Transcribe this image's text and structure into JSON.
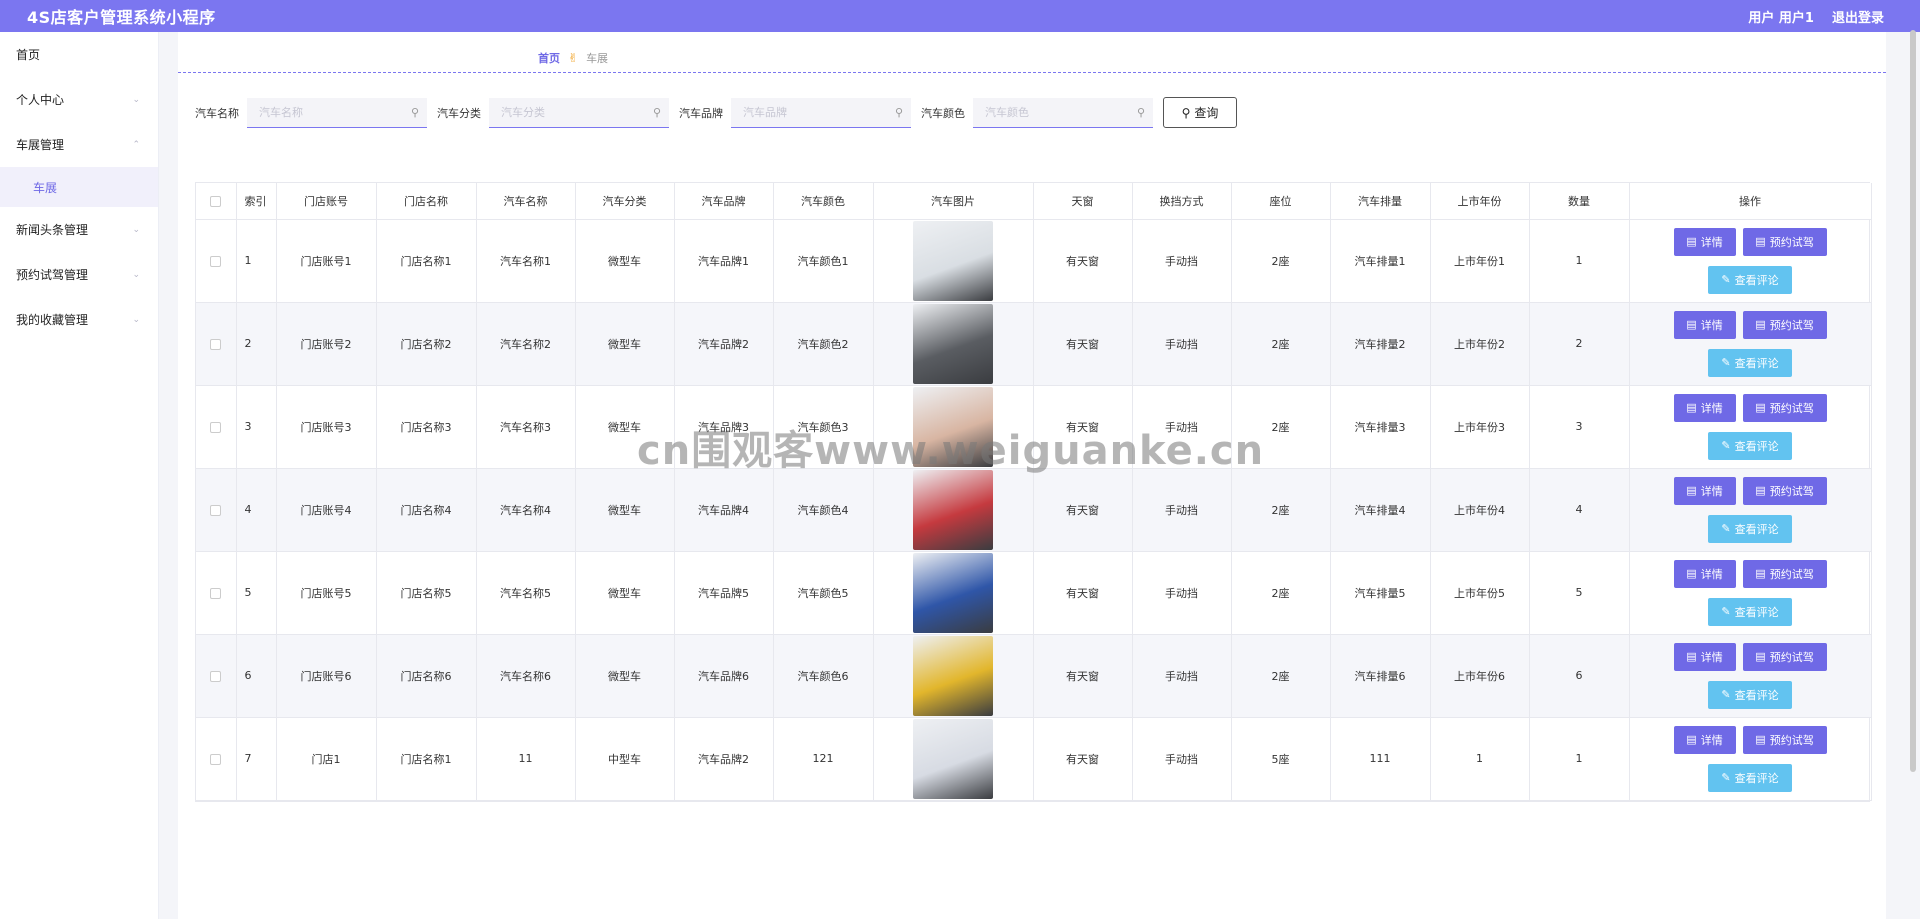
{
  "app": {
    "title": "4S店客户管理系统小程序",
    "user_label": "用户 用户1",
    "logout_label": "退出登录"
  },
  "sidebar": {
    "items": [
      {
        "label": "首页"
      },
      {
        "label": "个人中心"
      },
      {
        "label": "车展管理"
      },
      {
        "label": "车展"
      },
      {
        "label": "新闻头条管理"
      },
      {
        "label": "预约试驾管理"
      },
      {
        "label": "我的收藏管理"
      }
    ]
  },
  "breadcrumb": {
    "home": "首页",
    "current": "车展"
  },
  "search": {
    "fields": [
      {
        "label": "汽车名称",
        "placeholder": "汽车名称"
      },
      {
        "label": "汽车分类",
        "placeholder": "汽车分类"
      },
      {
        "label": "汽车品牌",
        "placeholder": "汽车品牌"
      },
      {
        "label": "汽车颜色",
        "placeholder": "汽车颜色"
      }
    ],
    "query_label": "查询"
  },
  "table": {
    "headers": [
      "索引",
      "门店账号",
      "门店名称",
      "汽车名称",
      "汽车分类",
      "汽车品牌",
      "汽车颜色",
      "汽车图片",
      "天窗",
      "换挡方式",
      "座位",
      "汽车排量",
      "上市年份",
      "数量",
      "操作"
    ],
    "rows": [
      {
        "idx": "1",
        "store_account": "门店账号1",
        "store_name": "门店名称1",
        "car_name": "汽车名称1",
        "category": "微型车",
        "brand": "汽车品牌1",
        "color": "汽车颜色1",
        "sunroof": "有天窗",
        "gear": "手动挡",
        "seats": "2座",
        "displacement": "汽车排量1",
        "year": "上市年份1",
        "qty": "1",
        "img_color": "#d9dee3"
      },
      {
        "idx": "2",
        "store_account": "门店账号2",
        "store_name": "门店名称2",
        "car_name": "汽车名称2",
        "category": "微型车",
        "brand": "汽车品牌2",
        "color": "汽车颜色2",
        "sunroof": "有天窗",
        "gear": "手动挡",
        "seats": "2座",
        "displacement": "汽车排量2",
        "year": "上市年份2",
        "qty": "2",
        "img_color": "#5a5d62"
      },
      {
        "idx": "3",
        "store_account": "门店账号3",
        "store_name": "门店名称3",
        "car_name": "汽车名称3",
        "category": "微型车",
        "brand": "汽车品牌3",
        "color": "汽车颜色3",
        "sunroof": "有天窗",
        "gear": "手动挡",
        "seats": "2座",
        "displacement": "汽车排量3",
        "year": "上市年份3",
        "qty": "3",
        "img_color": "#d8b5a2"
      },
      {
        "idx": "4",
        "store_account": "门店账号4",
        "store_name": "门店名称4",
        "car_name": "汽车名称4",
        "category": "微型车",
        "brand": "汽车品牌4",
        "color": "汽车颜色4",
        "sunroof": "有天窗",
        "gear": "手动挡",
        "seats": "2座",
        "displacement": "汽车排量4",
        "year": "上市年份4",
        "qty": "4",
        "img_color": "#c53a3f"
      },
      {
        "idx": "5",
        "store_account": "门店账号5",
        "store_name": "门店名称5",
        "car_name": "汽车名称5",
        "category": "微型车",
        "brand": "汽车品牌5",
        "color": "汽车颜色5",
        "sunroof": "有天窗",
        "gear": "手动挡",
        "seats": "2座",
        "displacement": "汽车排量5",
        "year": "上市年份5",
        "qty": "5",
        "img_color": "#2f56a8"
      },
      {
        "idx": "6",
        "store_account": "门店账号6",
        "store_name": "门店名称6",
        "car_name": "汽车名称6",
        "category": "微型车",
        "brand": "汽车品牌6",
        "color": "汽车颜色6",
        "sunroof": "有天窗",
        "gear": "手动挡",
        "seats": "2座",
        "displacement": "汽车排量6",
        "year": "上市年份6",
        "qty": "6",
        "img_color": "#e2b62c"
      },
      {
        "idx": "7",
        "store_account": "门店1",
        "store_name": "门店名称1",
        "car_name": "11",
        "category": "中型车",
        "brand": "汽车品牌2",
        "color": "121",
        "sunroof": "有天窗",
        "gear": "手动挡",
        "seats": "5座",
        "displacement": "111",
        "year": "1",
        "qty": "1",
        "img_color": "#d7dbe3"
      }
    ],
    "actions": {
      "detail": "详情",
      "test_drive": "预约试驾",
      "comments": "查看评论"
    }
  },
  "watermark": "cn围观客www.weiguanke.cn",
  "colors": {
    "accent": "#7b76f0",
    "primary_btn": "#6f69e6",
    "comment_btn": "#62c3f0"
  }
}
